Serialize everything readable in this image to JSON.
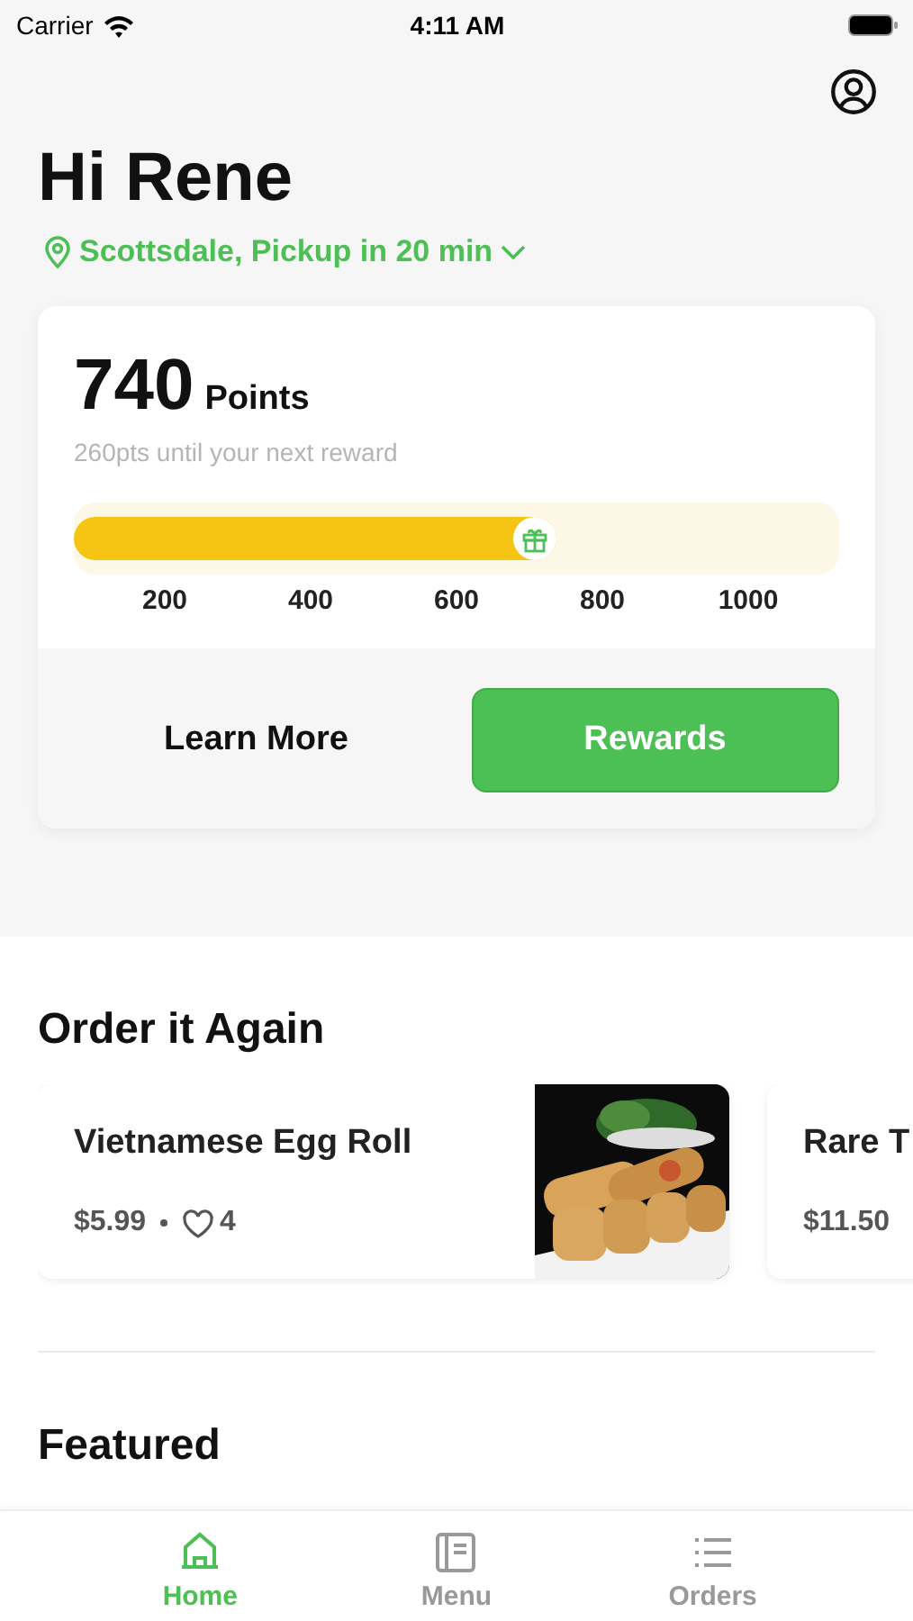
{
  "status_bar": {
    "carrier": "Carrier",
    "time": "4:11 AM"
  },
  "greeting": "Hi Rene",
  "location": "Scottsdale, Pickup in 20 min",
  "rewards": {
    "points": "740",
    "points_label": "Points",
    "subtitle": "260pts until your next reward",
    "level": 0.63,
    "ticks": [
      "200",
      "400",
      "600",
      "800",
      "1000"
    ],
    "buttons": [
      {
        "label": "Learn More",
        "kind": "plain"
      },
      {
        "label": "Rewards",
        "kind": "primary"
      }
    ]
  },
  "order_again": {
    "title": "Order it Again",
    "items": [
      {
        "name": "Vietnamese Egg Roll",
        "price": "$5.99",
        "likes": "4"
      },
      {
        "name": "Rare T",
        "price": "$11.50"
      }
    ]
  },
  "featured": {
    "title": "Featured"
  },
  "tabs": [
    {
      "label": "Home",
      "kind": "home",
      "selected": true
    },
    {
      "label": "Menu",
      "kind": "menu",
      "selected": false
    },
    {
      "label": "Orders",
      "kind": "orders",
      "selected": false
    }
  ]
}
